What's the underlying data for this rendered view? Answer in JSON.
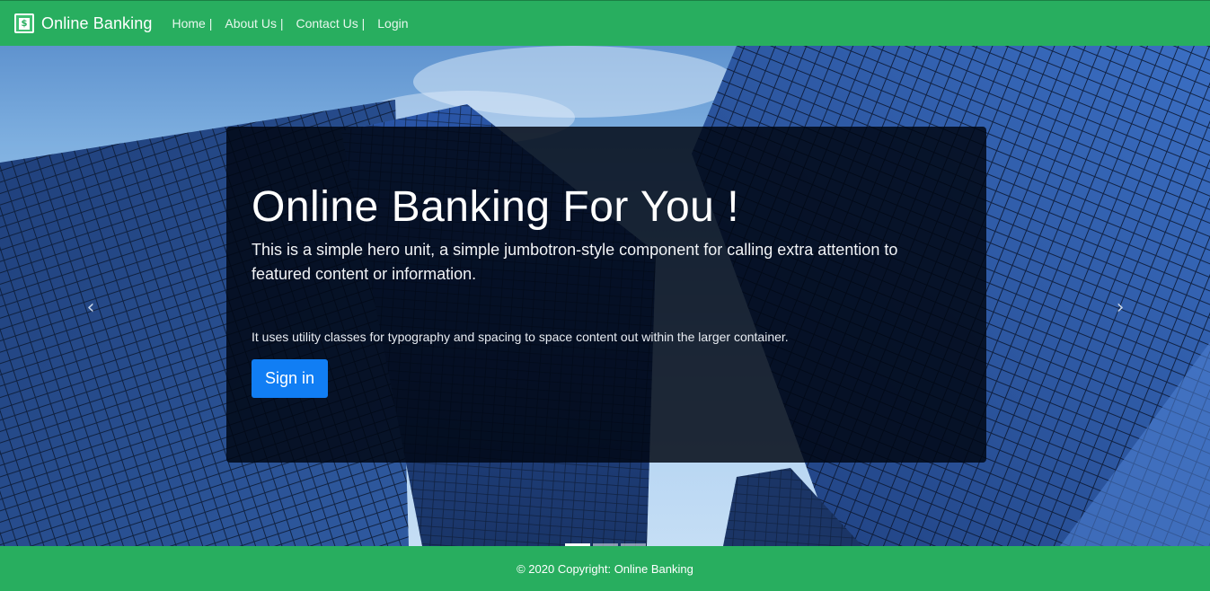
{
  "navbar": {
    "brand_icon": "dollar-icon",
    "brand_icon_glyph": "$",
    "brand_text": "Online Banking",
    "links": [
      {
        "label": "Home |"
      },
      {
        "label": "About Us |"
      },
      {
        "label": "Contact Us |"
      },
      {
        "label": "Login"
      }
    ]
  },
  "carousel": {
    "prev_icon": "chevron-left-icon",
    "next_icon": "chevron-right-icon",
    "prev_glyph": "‹",
    "next_glyph": "›",
    "slide_count": 3,
    "active_slide": 1
  },
  "hero": {
    "title": "Online Banking For You !",
    "lead": "This is a simple hero unit, a simple jumbotron-style component for calling extra attention to featured content or information.",
    "text": "It uses utility classes for typography and spacing to space content out within the larger container.",
    "button_label": "Sign in"
  },
  "footer": {
    "copyright": "© 2020 Copyright: Online Banking"
  },
  "colors": {
    "brand_green": "#28ae5f",
    "button_blue": "#117ef4",
    "overlay": "#000612"
  }
}
